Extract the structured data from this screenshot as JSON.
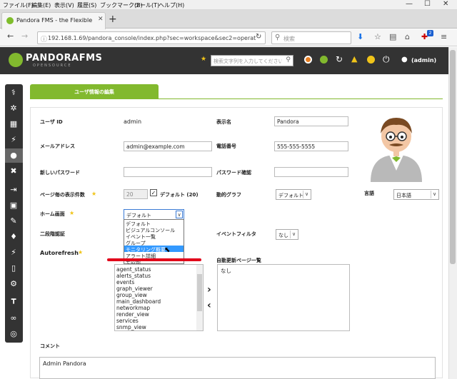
{
  "browser": {
    "menu": [
      "ファイル(F)",
      "編集(E)",
      "表示(V)",
      "履歴(S)",
      "ブックマーク(B)",
      "ツール(T)",
      "ヘルプ(H)"
    ],
    "tab_title": "Pandora FMS - the Flexible M",
    "url": "192.168.1.69/pandora_console/index.php?sec=workspace&sec2=operat",
    "search_placeholder": "検索",
    "badge": "2"
  },
  "header": {
    "logo": "PANDORAFMS",
    "logo_sub": "OPENSOURCE",
    "search_placeholder": "検索文字列を入力してください",
    "user": "(admin)"
  },
  "page": {
    "tab_label": "ユーザ情報の編集",
    "fields": {
      "user_id_label": "ユーザ ID",
      "user_id_value": "admin",
      "fullname_label": "表示名",
      "fullname_value": "Pandora",
      "email_label": "メールアドレス",
      "email_value": "admin@example.com",
      "phone_label": "電話番号",
      "phone_value": "555-555-5555",
      "newpass_label": "新しいパスワード",
      "confirm_label": "パスワード確認",
      "blocksize_label": "ページ毎の表示件数",
      "blocksize_value": "20",
      "blocksize_default": "デフォルト (20)",
      "interactive_label": "動的グラフ",
      "interactive_value": "デフォルト",
      "language_label": "言語",
      "language_value": "日本語",
      "home_label": "ホーム画面",
      "home_value": "デフォルト",
      "twofactor_label": "二段階認証",
      "eventfilter_label": "イベントフィルタ",
      "eventfilter_value": "なし",
      "autorefresh_label": "Autorefresh",
      "autorefresh_pages_label": "自動更新ページ一覧",
      "autorefresh_right_value": "なし",
      "comment_label": "コメント",
      "comment_value": "Admin Pandora"
    },
    "home_options": [
      "デフォルト",
      "ビジュアルコンソール",
      "イベント一覧",
      "グループ",
      "モニタリング概要",
      "アラート詳細",
      "その他"
    ],
    "highlighted_option": "モニタリング概要",
    "autorefresh_list": [
      "agent_status",
      "alerts_status",
      "events",
      "graph_viewer",
      "group_view",
      "main_dashboard",
      "networkmap",
      "render_view",
      "services",
      "snmp_view"
    ],
    "move_right": "›",
    "move_left": "‹"
  },
  "colors": {
    "accent": "#82b92e",
    "header_bg": "#333333",
    "highlight": "#3399ff",
    "annotation": "#e1001a"
  }
}
